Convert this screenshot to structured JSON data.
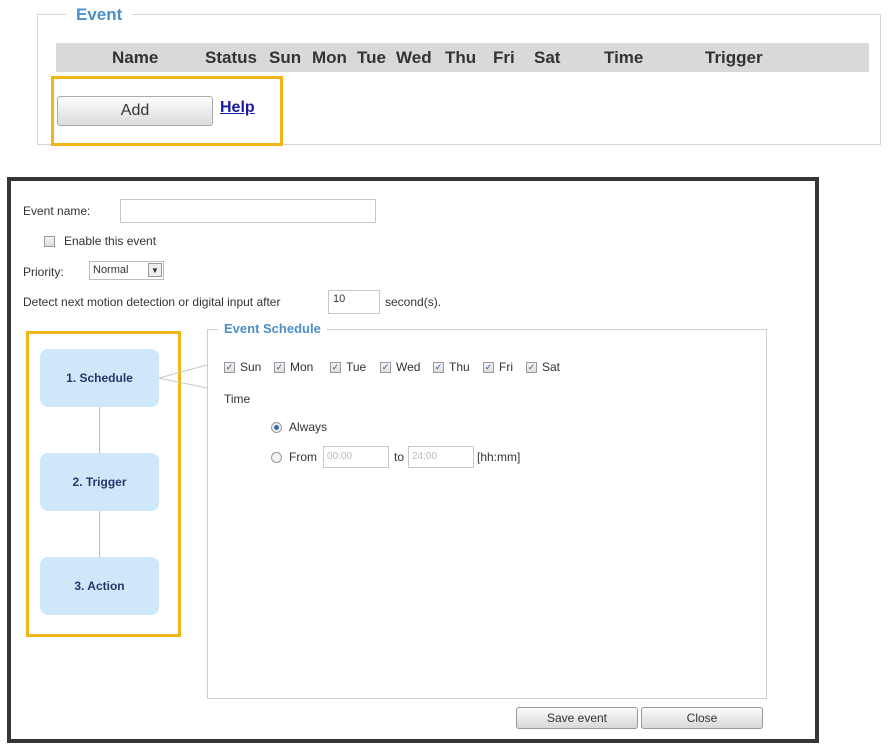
{
  "event_panel": {
    "legend": "Event",
    "columns": [
      "Name",
      "Status",
      "Sun",
      "Mon",
      "Tue",
      "Wed",
      "Thu",
      "Fri",
      "Sat",
      "Time",
      "Trigger"
    ],
    "add_label": "Add",
    "help_label": "Help"
  },
  "dialog": {
    "event_name_label": "Event name:",
    "event_name_value": "",
    "enable_label": "Enable this event",
    "enable_checked": false,
    "priority_label": "Priority:",
    "priority_value": "Normal",
    "detect_label": "Detect next motion detection or digital input after",
    "detect_value": "10",
    "detect_unit": "second(s).",
    "steps": [
      "1. Schedule",
      "2. Trigger",
      "3. Action"
    ],
    "schedule": {
      "legend": "Event Schedule",
      "days": [
        {
          "label": "Sun",
          "checked": true
        },
        {
          "label": "Mon",
          "checked": true
        },
        {
          "label": "Tue",
          "checked": true
        },
        {
          "label": "Wed",
          "checked": true
        },
        {
          "label": "Thu",
          "checked": true
        },
        {
          "label": "Fri",
          "checked": true
        },
        {
          "label": "Sat",
          "checked": true
        }
      ],
      "time_label": "Time",
      "always_label": "Always",
      "always_selected": true,
      "from_label": "From",
      "from_value": "00:00",
      "to_label": "to",
      "to_value": "24:00",
      "format_label": "[hh:mm]"
    },
    "save_label": "Save event",
    "close_label": "Close"
  },
  "colors": {
    "accent": "#f2b418",
    "legend_blue": "#4a8fc9",
    "step_fill": "#cfe8f9"
  }
}
